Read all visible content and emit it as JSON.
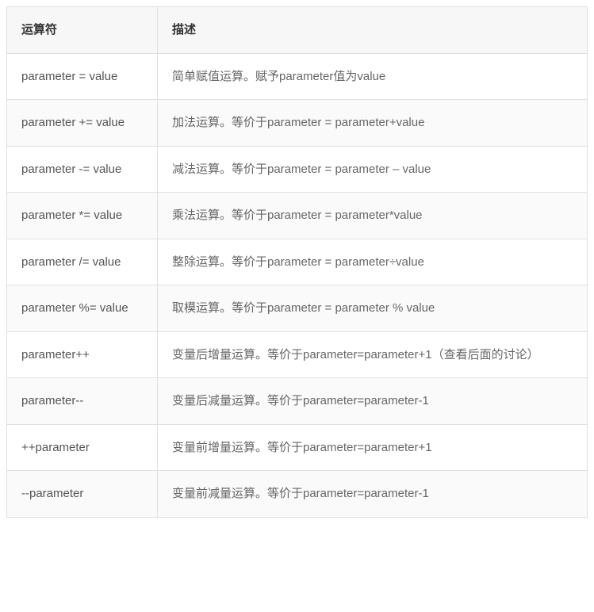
{
  "table": {
    "headers": {
      "operator": "运算符",
      "description": "描述"
    },
    "rows": [
      {
        "operator": "parameter = value",
        "description": "简单赋值运算。赋予parameter值为value"
      },
      {
        "operator": "parameter += value",
        "description": "加法运算。等价于parameter = parameter+value"
      },
      {
        "operator": "parameter -= value",
        "description": "减法运算。等价于parameter = parameter – value"
      },
      {
        "operator": "parameter *= value",
        "description": "乘法运算。等价于parameter = parameter*value"
      },
      {
        "operator": "parameter /= value",
        "description": "整除运算。等价于parameter = parameter÷value"
      },
      {
        "operator": "parameter %= value",
        "description": "取模运算。等价于parameter = parameter % value"
      },
      {
        "operator": "parameter++",
        "description": "变量后增量运算。等价于parameter=parameter+1（查看后面的讨论）"
      },
      {
        "operator": "parameter--",
        "description": "变量后减量运算。等价于parameter=parameter-1"
      },
      {
        "operator": "++parameter",
        "description": "变量前增量运算。等价于parameter=parameter+1"
      },
      {
        "operator": "--parameter",
        "description": "变量前减量运算。等价于parameter=parameter-1"
      }
    ]
  }
}
